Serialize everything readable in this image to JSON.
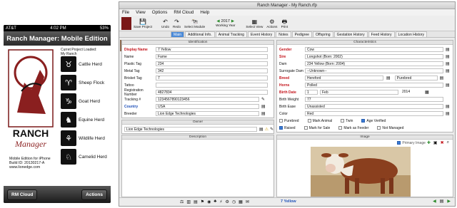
{
  "phone": {
    "carrier": "AT&T",
    "time": "4:02 PM",
    "battery": "53%",
    "title": "Ranch Manager: Mobile Edition",
    "current_label": "Curret Project Loaded:",
    "current_value": "My Ranch",
    "logo_text": "RANCH Manager",
    "herds": [
      {
        "label": "Cattle Herd",
        "icon": "cattle-icon"
      },
      {
        "label": "Sheep Flock",
        "icon": "sheep-icon"
      },
      {
        "label": "Goat Herd",
        "icon": "goat-icon"
      },
      {
        "label": "Equine Herd",
        "icon": "horse-icon"
      },
      {
        "label": "Wildlife Herd",
        "icon": "deer-icon"
      },
      {
        "label": "Camelid Herd",
        "icon": "llama-icon"
      }
    ],
    "info_line1": "Mobile Edition for iPhone",
    "info_line2": "Build ID: 20130217-A",
    "info_line3": "www.lionedge.com",
    "left_button": "RM Cloud",
    "right_button": "Actions"
  },
  "window": {
    "title": "Ranch Manager - My Ranch.rfp",
    "menu": [
      "File",
      "View",
      "Options",
      "RM Cloud",
      "Help"
    ],
    "toolbar": {
      "save": "Save Project",
      "undo": "Undo",
      "redo": "Redo",
      "module": "Select Module",
      "year": "2017",
      "working_year": "Working Year",
      "view": "Select View",
      "actions": "Actions",
      "print": "Print"
    },
    "tabs": [
      "Main",
      "Additional Info.",
      "Animal Tracking",
      "Event History",
      "Notes",
      "Pedigree",
      "Offspring",
      "Gestation History",
      "Feed History",
      "Location History"
    ],
    "identification_header": "Identification",
    "characteristics_header": "Characteristics",
    "owner_header": "Owner",
    "description_header": "Description",
    "image_header": "Image",
    "id_fields": [
      {
        "label": "Display Name",
        "value": "7 Yellow"
      },
      {
        "label": "Name",
        "value": "Fame"
      },
      {
        "label": "Plastic Tag",
        "value": "234"
      },
      {
        "label": "Metal Tag",
        "value": "342"
      },
      {
        "label": "Brisket Tag",
        "value": "7"
      },
      {
        "label": "Tattoo",
        "value": ""
      },
      {
        "label": "Registration Number",
        "value": "4827834"
      },
      {
        "label": "Tracking #",
        "value": "1234567890123456"
      },
      {
        "label": "Country",
        "value": "USA"
      },
      {
        "label": "Breeder",
        "value": "Lion Edge Technologies"
      }
    ],
    "char_fields": [
      {
        "label": "Gender",
        "value": "Cow"
      },
      {
        "label": "Sire",
        "value": "Longshot (Born: 2002)"
      },
      {
        "label": "Dam",
        "value": "234 Yellow (Born: 2004)"
      },
      {
        "label": "Surrogate Dam",
        "value": "--Unknown--"
      },
      {
        "label": "Breed",
        "value": "Hereford"
      },
      {
        "label": "Horns",
        "value": "Polled"
      },
      {
        "label": "Birth Date",
        "value": "1"
      },
      {
        "label": "Birth Weight",
        "value": "77"
      },
      {
        "label": "Birth Ease",
        "value": "Unassisted"
      },
      {
        "label": "Color",
        "value": "Red"
      }
    ],
    "purebred_select": "Purebred",
    "birth_month": "Feb",
    "birth_year": "2014",
    "check_row1": [
      {
        "label": "Purebred",
        "checked": false
      },
      {
        "label": "Mark Animal",
        "checked": false
      },
      {
        "label": "Twin",
        "checked": false
      },
      {
        "label": "Age Verified",
        "checked": true
      }
    ],
    "check_row2": [
      {
        "label": "Raised",
        "checked": true
      },
      {
        "label": "Mark for Sale",
        "checked": false
      },
      {
        "label": "Mark as Feeder",
        "checked": false
      },
      {
        "label": "Not Managed",
        "checked": false
      }
    ],
    "owner_value": "Lion Edge Technologies",
    "primary_image": "Primary Image",
    "status_name": "7 Yellow"
  }
}
